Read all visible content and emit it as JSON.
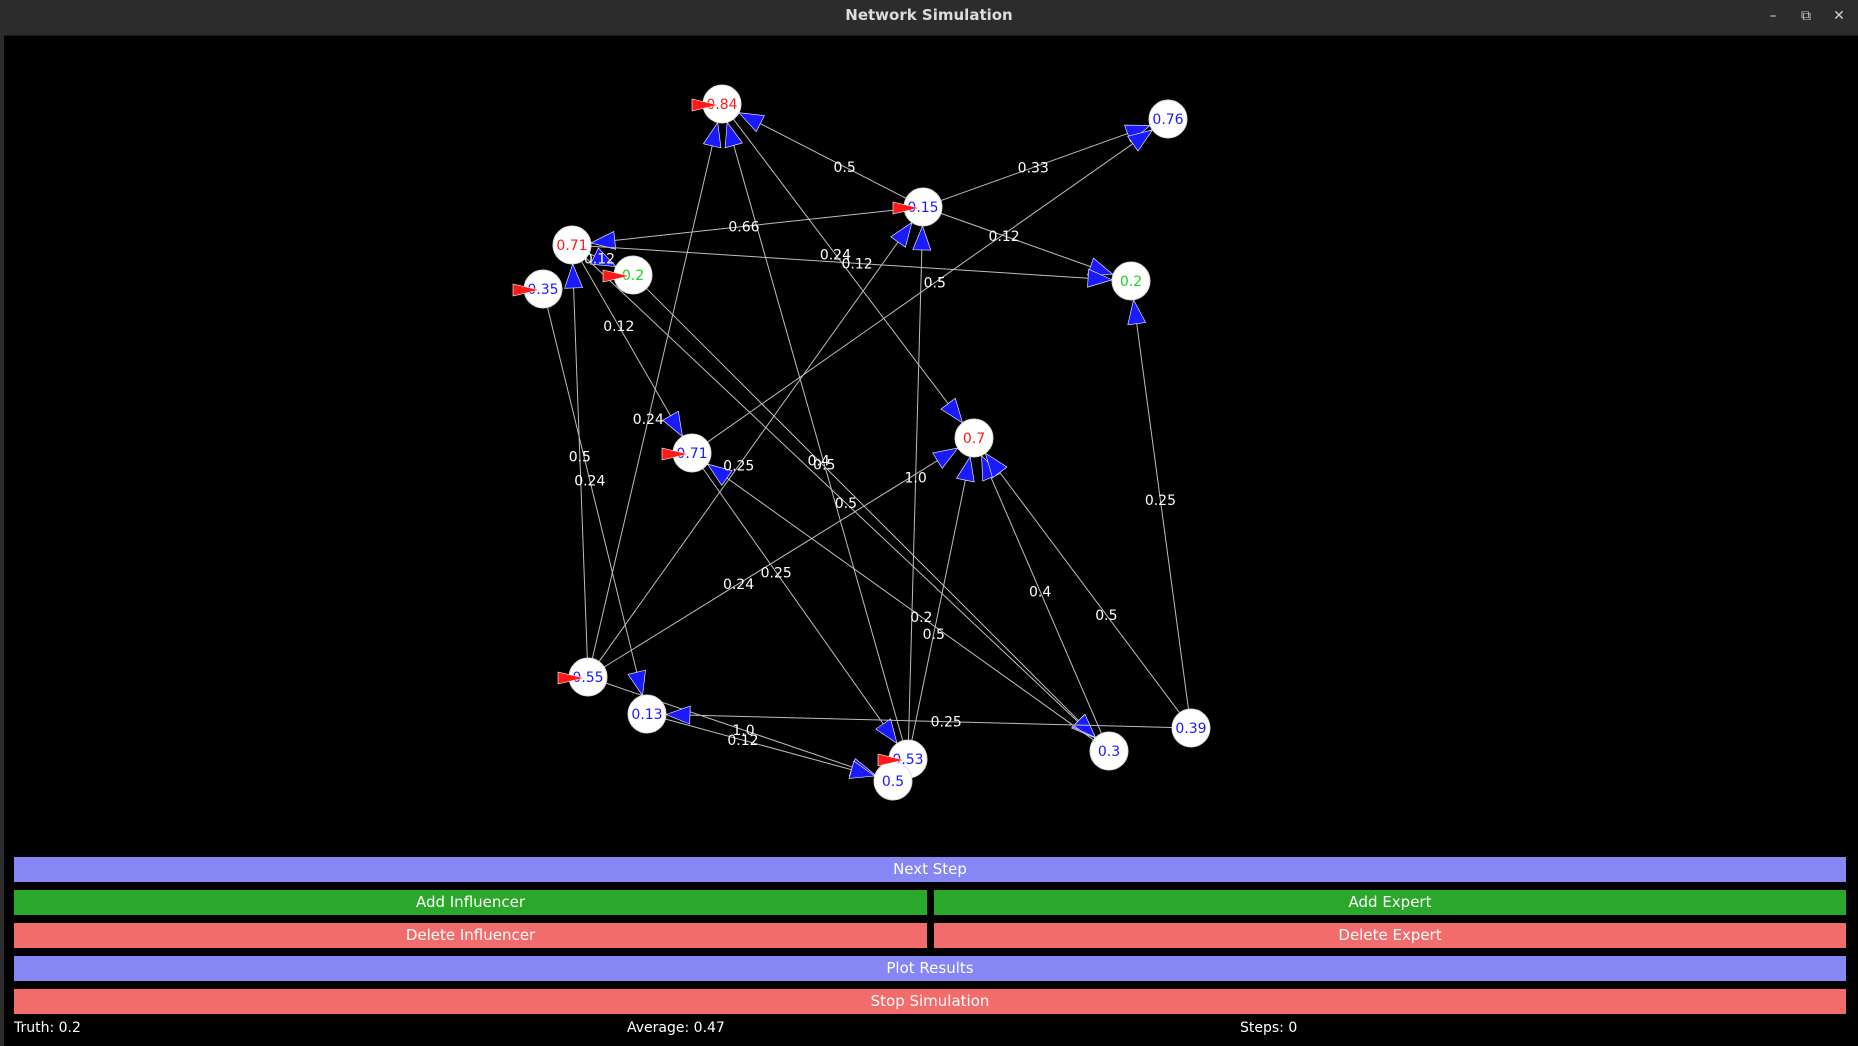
{
  "window": {
    "title": "Network Simulation",
    "minimize_glyph": "–",
    "restore_glyph": "⧉",
    "close_glyph": "✕"
  },
  "colors": {
    "influencer": "#ff1a1a",
    "expert": "#1a1aff",
    "truth": "#1ed11e",
    "edge": "#bdbdbd",
    "blue_button": "#8686f4",
    "green_button": "#2ba82b",
    "red_button": "#f36c6c"
  },
  "graph": {
    "nodes": [
      {
        "id": "n1",
        "label": "0.84",
        "kind": "influencer"
      },
      {
        "id": "n2",
        "label": "0.76",
        "kind": "expert"
      },
      {
        "id": "n3",
        "label": "0.15",
        "kind": "expert"
      },
      {
        "id": "n4",
        "label": "0.71",
        "kind": "influencer"
      },
      {
        "id": "n5",
        "label": "0.2",
        "kind": "truth"
      },
      {
        "id": "n6",
        "label": "0.35",
        "kind": "expert"
      },
      {
        "id": "n7",
        "label": "0.2",
        "kind": "truth"
      },
      {
        "id": "n8",
        "label": "0.71",
        "kind": "expert"
      },
      {
        "id": "n9",
        "label": "0.7",
        "kind": "influencer"
      },
      {
        "id": "n10",
        "label": "0.55",
        "kind": "expert"
      },
      {
        "id": "n11",
        "label": "0.13",
        "kind": "expert"
      },
      {
        "id": "n12",
        "label": "0.53",
        "kind": "expert"
      },
      {
        "id": "n13",
        "label": "0.5",
        "kind": "expert"
      },
      {
        "id": "n14",
        "label": "0.3",
        "kind": "expert"
      },
      {
        "id": "n15",
        "label": "0.39",
        "kind": "expert"
      }
    ],
    "edges": [
      {
        "from": "n3",
        "to": "n1",
        "weight": "0.5"
      },
      {
        "from": "n3",
        "to": "n2",
        "weight": "0.33"
      },
      {
        "from": "n3",
        "to": "n4",
        "weight": "0.66"
      },
      {
        "from": "n3",
        "to": "n7",
        "weight": "0.12"
      },
      {
        "from": "n1",
        "to": "n9",
        "weight": "0.24"
      },
      {
        "from": "n4",
        "to": "n7",
        "weight": "0.12"
      },
      {
        "from": "n4",
        "to": "n8",
        "weight": "0.12"
      },
      {
        "from": "n4",
        "to": "n5",
        "weight": "0.12"
      },
      {
        "from": "n4",
        "to": "n14",
        "weight": "0.5"
      },
      {
        "from": "n5",
        "to": "n14",
        "weight": "0.4"
      },
      {
        "from": "n6",
        "to": "n11",
        "weight": "0.24"
      },
      {
        "from": "n8",
        "to": "n2",
        "weight": "0.5"
      },
      {
        "from": "n8",
        "to": "n12",
        "weight": "0.25"
      },
      {
        "from": "n10",
        "to": "n1",
        "weight": "0.24"
      },
      {
        "from": "n10",
        "to": "n4",
        "weight": "0.5"
      },
      {
        "from": "n10",
        "to": "n9",
        "weight": "0.24"
      },
      {
        "from": "n10",
        "to": "n3",
        "weight": "0.25"
      },
      {
        "from": "n10",
        "to": "n13",
        "weight": "1.0"
      },
      {
        "from": "n11",
        "to": "n13",
        "weight": "0.12"
      },
      {
        "from": "n12",
        "to": "n1",
        "weight": "0.5"
      },
      {
        "from": "n12",
        "to": "n3",
        "weight": "1.0"
      },
      {
        "from": "n12",
        "to": "n9",
        "weight": "0.5"
      },
      {
        "from": "n14",
        "to": "n8",
        "weight": "0.2"
      },
      {
        "from": "n14",
        "to": "n9",
        "weight": "0.4"
      },
      {
        "from": "n15",
        "to": "n9",
        "weight": "0.5"
      },
      {
        "from": "n15",
        "to": "n11",
        "weight": "0.25"
      },
      {
        "from": "n15",
        "to": "n7",
        "weight": "0.25"
      }
    ]
  },
  "buttons": {
    "next_step": "Next Step",
    "add_influencer": "Add Influencer",
    "add_expert": "Add Expert",
    "delete_influencer": "Delete Influencer",
    "delete_expert": "Delete Expert",
    "plot_results": "Plot Results",
    "stop_simulation": "Stop Simulation"
  },
  "status": {
    "truth": "Truth: 0.2",
    "average": "Average: 0.47",
    "steps": "Steps: 0"
  }
}
